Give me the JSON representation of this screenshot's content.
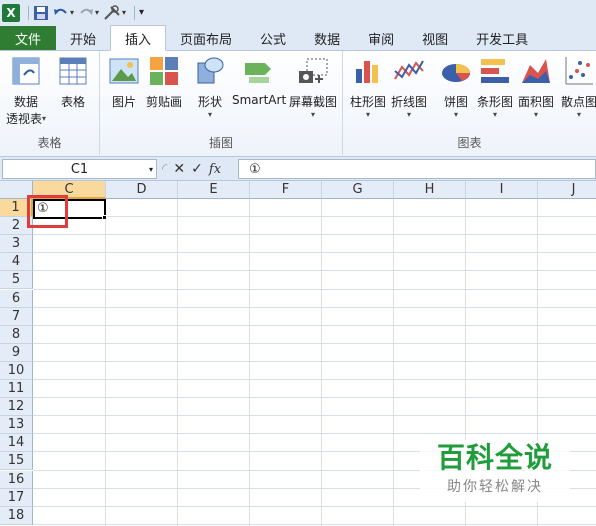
{
  "app": {
    "logo_letter": "X"
  },
  "tabs": [
    "文件",
    "开始",
    "插入",
    "页面布局",
    "公式",
    "数据",
    "审阅",
    "视图",
    "开发工具"
  ],
  "active_tab_index": 2,
  "ribbon": {
    "groups": [
      {
        "label": "表格",
        "buttons": [
          {
            "label": "数据",
            "label2": "透视表",
            "icon": "pivot-table-icon"
          },
          {
            "label": "表格",
            "icon": "table-icon"
          }
        ]
      },
      {
        "label": "插图",
        "buttons": [
          {
            "label": "图片",
            "icon": "picture-icon"
          },
          {
            "label": "剪贴画",
            "icon": "clipart-icon"
          },
          {
            "label": "形状",
            "icon": "shapes-icon"
          },
          {
            "label": "SmartArt",
            "icon": "smartart-icon"
          },
          {
            "label": "屏幕截图",
            "icon": "screenshot-icon"
          }
        ]
      },
      {
        "label": "图表",
        "buttons": [
          {
            "label": "柱形图",
            "icon": "column-chart-icon"
          },
          {
            "label": "折线图",
            "icon": "line-chart-icon"
          },
          {
            "label": "饼图",
            "icon": "pie-chart-icon"
          },
          {
            "label": "条形图",
            "icon": "bar-chart-icon"
          },
          {
            "label": "面积图",
            "icon": "area-chart-icon"
          },
          {
            "label": "散点图",
            "icon": "scatter-chart-icon"
          }
        ]
      }
    ]
  },
  "formula_bar": {
    "name_box": "C1",
    "fx": "fx",
    "value": "①"
  },
  "grid": {
    "columns": [
      "C",
      "D",
      "E",
      "F",
      "G",
      "H",
      "I",
      "J"
    ],
    "rows": [
      "1",
      "2",
      "3",
      "4",
      "5",
      "6",
      "7",
      "8",
      "9",
      "10",
      "11",
      "12",
      "13",
      "14",
      "15",
      "16",
      "17",
      "18"
    ],
    "active_cell_value": "①",
    "selected_column": "C",
    "selected_row": "1"
  },
  "watermark": {
    "title": "百科全说",
    "subtitle": "助你轻松解决"
  },
  "colors": {
    "file_tab": "#2e7d32",
    "highlight_header": "#f9d99c",
    "annotation": "#e03c3c",
    "watermark": "#1f9d3a"
  }
}
